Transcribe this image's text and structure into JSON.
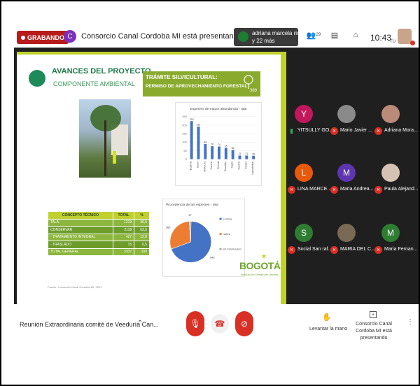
{
  "topbar": {
    "recording_label": "GRABANDO",
    "presenter_initial": "C",
    "presenter_text": "Consorcio Canal Cordoba MI está presentando",
    "pinned_name": "adriana marcela rico ...",
    "pinned_more": "y 22 más",
    "people_count": "29",
    "time": "10:43",
    "self_label": "TÚ"
  },
  "slide": {
    "title": "AVANCES DEL PROYECTO",
    "subtitle": "COMPONENTE AMBIENTAL",
    "tramite_title": "TRÁMITE SILVICULTURAL:",
    "tramite_sub": "PERMISO DE APROVECHAMIENTO FORESTAL",
    "tree_label": "389",
    "fuente": "Fuente: Consorcio Canal Cordoba MI, 2021",
    "logo_text": "BOGOTÁ",
    "logo_sub": "Instituto de Desarrollo Urbano",
    "table": {
      "headers": [
        "CONCEPTO TÉCNICO",
        "TOTAL",
        "%"
      ],
      "rows": [
        [
          "TALA",
          "1219",
          "36,6"
        ],
        [
          "CONSERVAR",
          "2118",
          "63,5"
        ],
        [
          "- TRATAMIENTO INTEGRAL",
          "427",
          "12,8"
        ],
        [
          "- TRASLADO",
          "15",
          "0,5"
        ],
        [
          "TOTAL GENERAL",
          "3337",
          "100"
        ]
      ]
    }
  },
  "chart_data": [
    {
      "type": "bar",
      "title": "Especies de mayor abundancia - tala",
      "categories": [
        "Eugenia",
        "Sauco",
        "Holly Liso",
        "Caucho",
        "Chicala",
        "Eucalipto",
        "Cajeto",
        "Caucho",
        "Cerezo",
        "Liquidámbar"
      ],
      "values": [
        223,
        191,
        89,
        76,
        74,
        65,
        54,
        21,
        21,
        20
      ],
      "ylim": [
        0,
        250
      ],
      "yticks": [
        0,
        50,
        100,
        150,
        200,
        250
      ]
    },
    {
      "type": "pie",
      "title": "Procedencia de las especies - tala",
      "labels": [
        "exótica",
        "nativa",
        "sin información"
      ],
      "values": [
        842,
        360,
        17
      ],
      "colors": [
        "#4472c4",
        "#ed7d31",
        "#a5a5a5"
      ]
    }
  ],
  "participants": [
    {
      "initial": "Y",
      "name": "YITSULLY GO...",
      "color": "#c2185b",
      "muted": false
    },
    {
      "initial": "",
      "name": "Mario Javier ...",
      "color": "#8a8a8a",
      "muted": true
    },
    {
      "initial": "",
      "name": "Adriana Mora...",
      "color": "#b98b78",
      "muted": true
    },
    {
      "initial": "L",
      "name": "LINA MARCE...",
      "color": "#e8590c",
      "muted": true
    },
    {
      "initial": "M",
      "name": "Maria Andrea...",
      "color": "#5e35b1",
      "muted": true
    },
    {
      "initial": "",
      "name": "Paula Alejand...",
      "color": "#d6c2b4",
      "muted": true
    },
    {
      "initial": "S",
      "name": "Social San raf...",
      "color": "#2e7d32",
      "muted": true
    },
    {
      "initial": "",
      "name": "MARIA DEL C...",
      "color": "#7a6a55",
      "muted": true
    },
    {
      "initial": "M",
      "name": "Maria Fernan...",
      "color": "#2e7d32",
      "muted": true
    }
  ],
  "bottom": {
    "meeting_name": "Reunión Extraordinaria comité de Veeduría Can...",
    "raise_hand": "Levantar la mano",
    "presenting": "Consorcio Canal Cordoba MI está presentando"
  }
}
